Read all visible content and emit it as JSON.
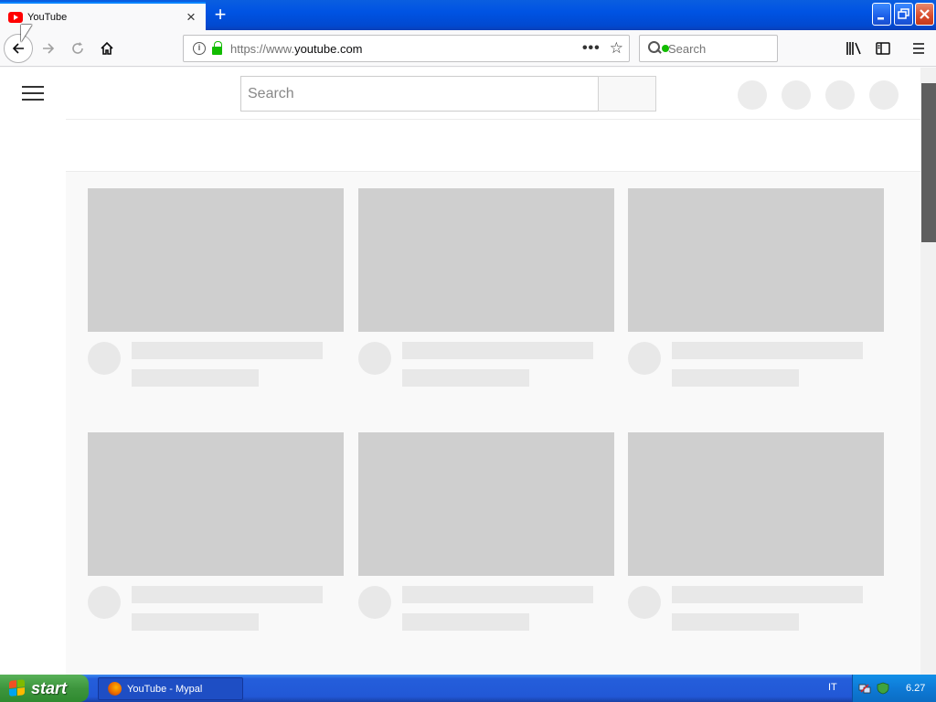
{
  "browser": {
    "tab_title": "YouTube",
    "tab_close_icon": "×",
    "new_tab_icon": "+",
    "url_scheme": "https://www.",
    "url_domain": "youtube.com",
    "search_placeholder": "Search",
    "accent_color": "#0a84ff",
    "secure_lock_color": "#12bc00"
  },
  "youtube": {
    "search_placeholder": "Search",
    "brand_color": "#ff0000",
    "masthead_placeholder_circles": 4,
    "skeleton_cards": 6
  },
  "taskbar": {
    "start_label": "start",
    "task_item_label": "YouTube - Mypal",
    "language": "IT",
    "clock": "6.27"
  }
}
